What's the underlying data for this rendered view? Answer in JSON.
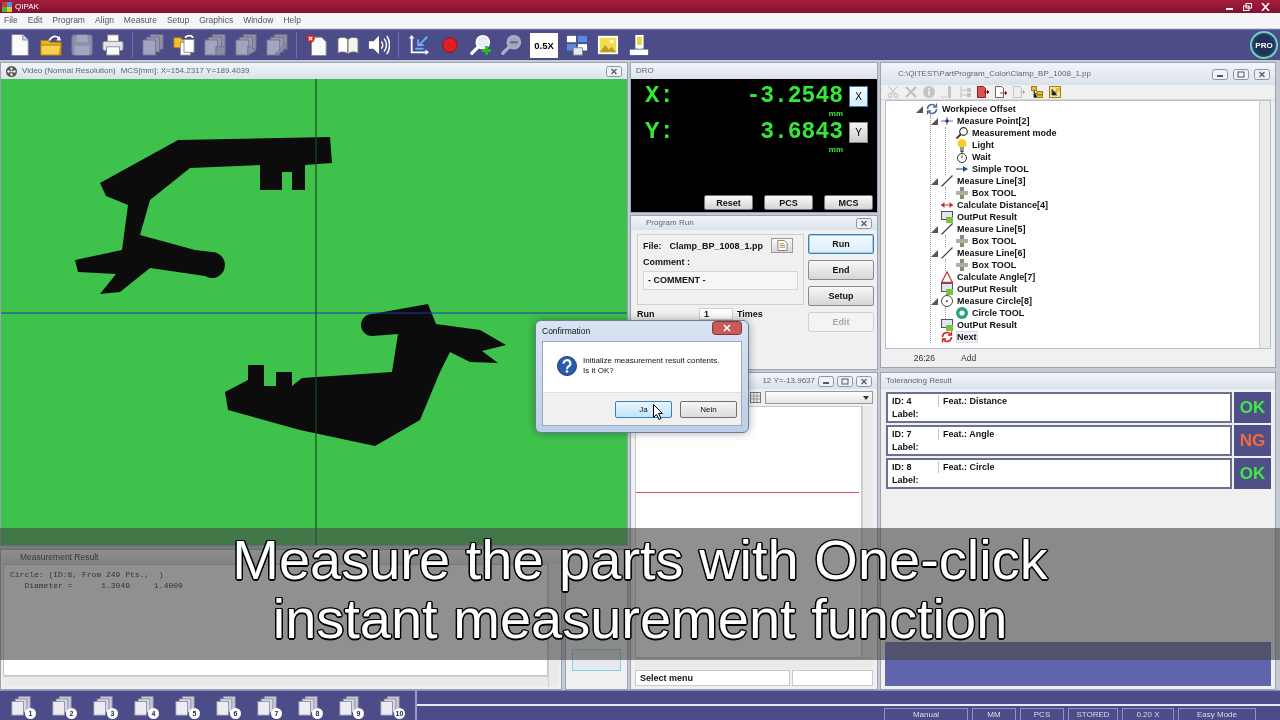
{
  "app": {
    "title": "QIPAK"
  },
  "menu": [
    "File",
    "Edit",
    "Program",
    "Align",
    "Measure",
    "Setup",
    "Graphics",
    "Window",
    "Help"
  ],
  "toolbar": {
    "groups": [
      [
        {
          "kind": "new",
          "disabled": false
        },
        {
          "kind": "open",
          "disabled": false
        },
        {
          "kind": "save",
          "disabled": true
        },
        {
          "kind": "print",
          "disabled": false
        }
      ],
      [
        {
          "kind": "copy",
          "disabled": true
        },
        {
          "kind": "import",
          "disabled": false
        },
        {
          "kind": "stack",
          "disabled": true
        },
        {
          "kind": "play",
          "disabled": true
        },
        {
          "kind": "edit",
          "disabled": true
        }
      ],
      [
        {
          "kind": "delete",
          "disabled": false
        },
        {
          "kind": "book",
          "disabled": false
        },
        {
          "kind": "sound",
          "disabled": false
        }
      ],
      [
        {
          "kind": "axes",
          "disabled": false
        },
        {
          "kind": "record",
          "disabled": false
        },
        {
          "kind": "zoomin",
          "disabled": false
        },
        {
          "kind": "zoomout",
          "disabled": true
        },
        {
          "kind": "magnification",
          "label": "0.5X",
          "disabled": false
        },
        {
          "kind": "layout",
          "disabled": false
        },
        {
          "kind": "image",
          "disabled": false
        },
        {
          "kind": "light",
          "disabled": false
        }
      ]
    ],
    "logo": "PRO"
  },
  "video": {
    "title": "Video (Normal Resolution)",
    "coordinates": "MCS[mm]: X=154.2317 Y=189.4039"
  },
  "measurement_result": {
    "title": "Measurement Result",
    "lines": [
      "Circle: (ID:8, From 249 Pts.,  )",
      "   Diameter =      1.3049     1.4000"
    ]
  },
  "dro": {
    "title": "DRO",
    "axes": [
      {
        "label": "X:",
        "value": "-3.2548",
        "unit": "mm",
        "button": "X",
        "selected": true
      },
      {
        "label": "Y:",
        "value": "3.6843",
        "unit": "mm",
        "button": "Y",
        "selected": false
      }
    ],
    "buttons": [
      "Reset",
      "PCS",
      "MCS"
    ]
  },
  "program_run": {
    "title": "Program Run",
    "file_label": "File:",
    "file": "Clamp_BP_1008_1.pp",
    "comment_label": "Comment :",
    "comment": "- COMMENT -",
    "run_label": "Run",
    "run_count": "1",
    "times_label": "Times",
    "buttons": [
      {
        "label": "Run",
        "focused": true,
        "disabled": false
      },
      {
        "label": "End",
        "focused": false,
        "disabled": false
      },
      {
        "label": "Setup",
        "focused": false,
        "disabled": false
      },
      {
        "label": "Edit",
        "focused": false,
        "disabled": true
      }
    ]
  },
  "graph_panel": {
    "title": "12 Y=-13.9637",
    "status": "Select menu"
  },
  "program_tree": {
    "title": "C:\\QITEST\\PartProgram_Color\\Clamp_BP_1008_1.pp",
    "tools": [
      {
        "kind": "cut",
        "disabled": true
      },
      {
        "kind": "delete",
        "disabled": true
      },
      {
        "kind": "info",
        "disabled": true
      },
      {
        "kind": "insert",
        "disabled": true
      },
      {
        "kind": "branch",
        "disabled": true
      },
      {
        "kind": "export",
        "disabled": false
      },
      {
        "kind": "import",
        "disabled": false
      },
      {
        "kind": "detach",
        "disabled": true
      },
      {
        "kind": "expand",
        "disabled": false
      },
      {
        "kind": "collapse",
        "disabled": false
      }
    ],
    "nodes": [
      {
        "label": "Workpiece Offset",
        "kind": "offset",
        "selected": false,
        "expanded": true,
        "children": [
          {
            "label": "Measure Point[2]",
            "kind": "point",
            "selected": false,
            "expanded": true,
            "children": [
              {
                "label": "Measurement mode",
                "kind": "mode",
                "selected": false
              },
              {
                "label": "Light",
                "kind": "light",
                "selected": false
              },
              {
                "label": "Wait",
                "kind": "wait",
                "selected": false
              },
              {
                "label": "Simple TOOL",
                "kind": "simple",
                "selected": false
              }
            ]
          },
          {
            "label": "Measure Line[3]",
            "kind": "line",
            "selected": false,
            "expanded": true,
            "children": [
              {
                "label": "Box TOOL",
                "kind": "box",
                "selected": false
              }
            ]
          },
          {
            "label": "Calculate Distance[4]",
            "kind": "distance",
            "selected": false
          },
          {
            "label": "OutPut Result",
            "kind": "output",
            "selected": false
          },
          {
            "label": "Measure Line[5]",
            "kind": "line",
            "selected": false,
            "expanded": true,
            "children": [
              {
                "label": "Box TOOL",
                "kind": "box",
                "selected": false
              }
            ]
          },
          {
            "label": "Measure Line[6]",
            "kind": "line",
            "selected": false,
            "expanded": true,
            "children": [
              {
                "label": "Box TOOL",
                "kind": "box",
                "selected": false
              }
            ]
          },
          {
            "label": "Calculate Angle[7]",
            "kind": "angle",
            "selected": false
          },
          {
            "label": "OutPut Result",
            "kind": "output",
            "selected": false
          },
          {
            "label": "Measure Circle[8]",
            "kind": "circle",
            "selected": false,
            "expanded": true,
            "children": [
              {
                "label": "Circle TOOL",
                "kind": "circletool",
                "selected": false
              }
            ]
          },
          {
            "label": "OutPut Result",
            "kind": "output",
            "selected": false
          },
          {
            "label": "Next",
            "kind": "next",
            "selected": true
          }
        ]
      }
    ],
    "status": {
      "position": "26:26",
      "mode": "Add"
    }
  },
  "tolerancing": {
    "title": "Tolerancing Result",
    "results": [
      {
        "id": "ID: 4",
        "feature": "Feat.: Distance",
        "label": "Label:",
        "verdict": "OK",
        "pass": true
      },
      {
        "id": "ID: 7",
        "feature": "Feat.: Angle",
        "label": "Label:",
        "verdict": "NG",
        "pass": false
      },
      {
        "id": "ID: 8",
        "feature": "Feat.: Circle",
        "label": "Label:",
        "verdict": "OK",
        "pass": true
      }
    ]
  },
  "slots": [
    "1",
    "2",
    "3",
    "4",
    "5",
    "6",
    "7",
    "8",
    "9",
    "10"
  ],
  "status_bar": [
    "Manual",
    "MM",
    "PCS",
    "STORED",
    "0.20 X",
    "Easy Mode"
  ],
  "dialog": {
    "title": "Confirmation",
    "message": "Initialize measurement result contents.\nIs it OK?",
    "buttons": [
      {
        "label": "Ja",
        "focused": true
      },
      {
        "label": "Nein",
        "focused": false
      }
    ]
  },
  "caption": {
    "lines": [
      "Measure the parts with One-click",
      "instant measurement function"
    ]
  }
}
